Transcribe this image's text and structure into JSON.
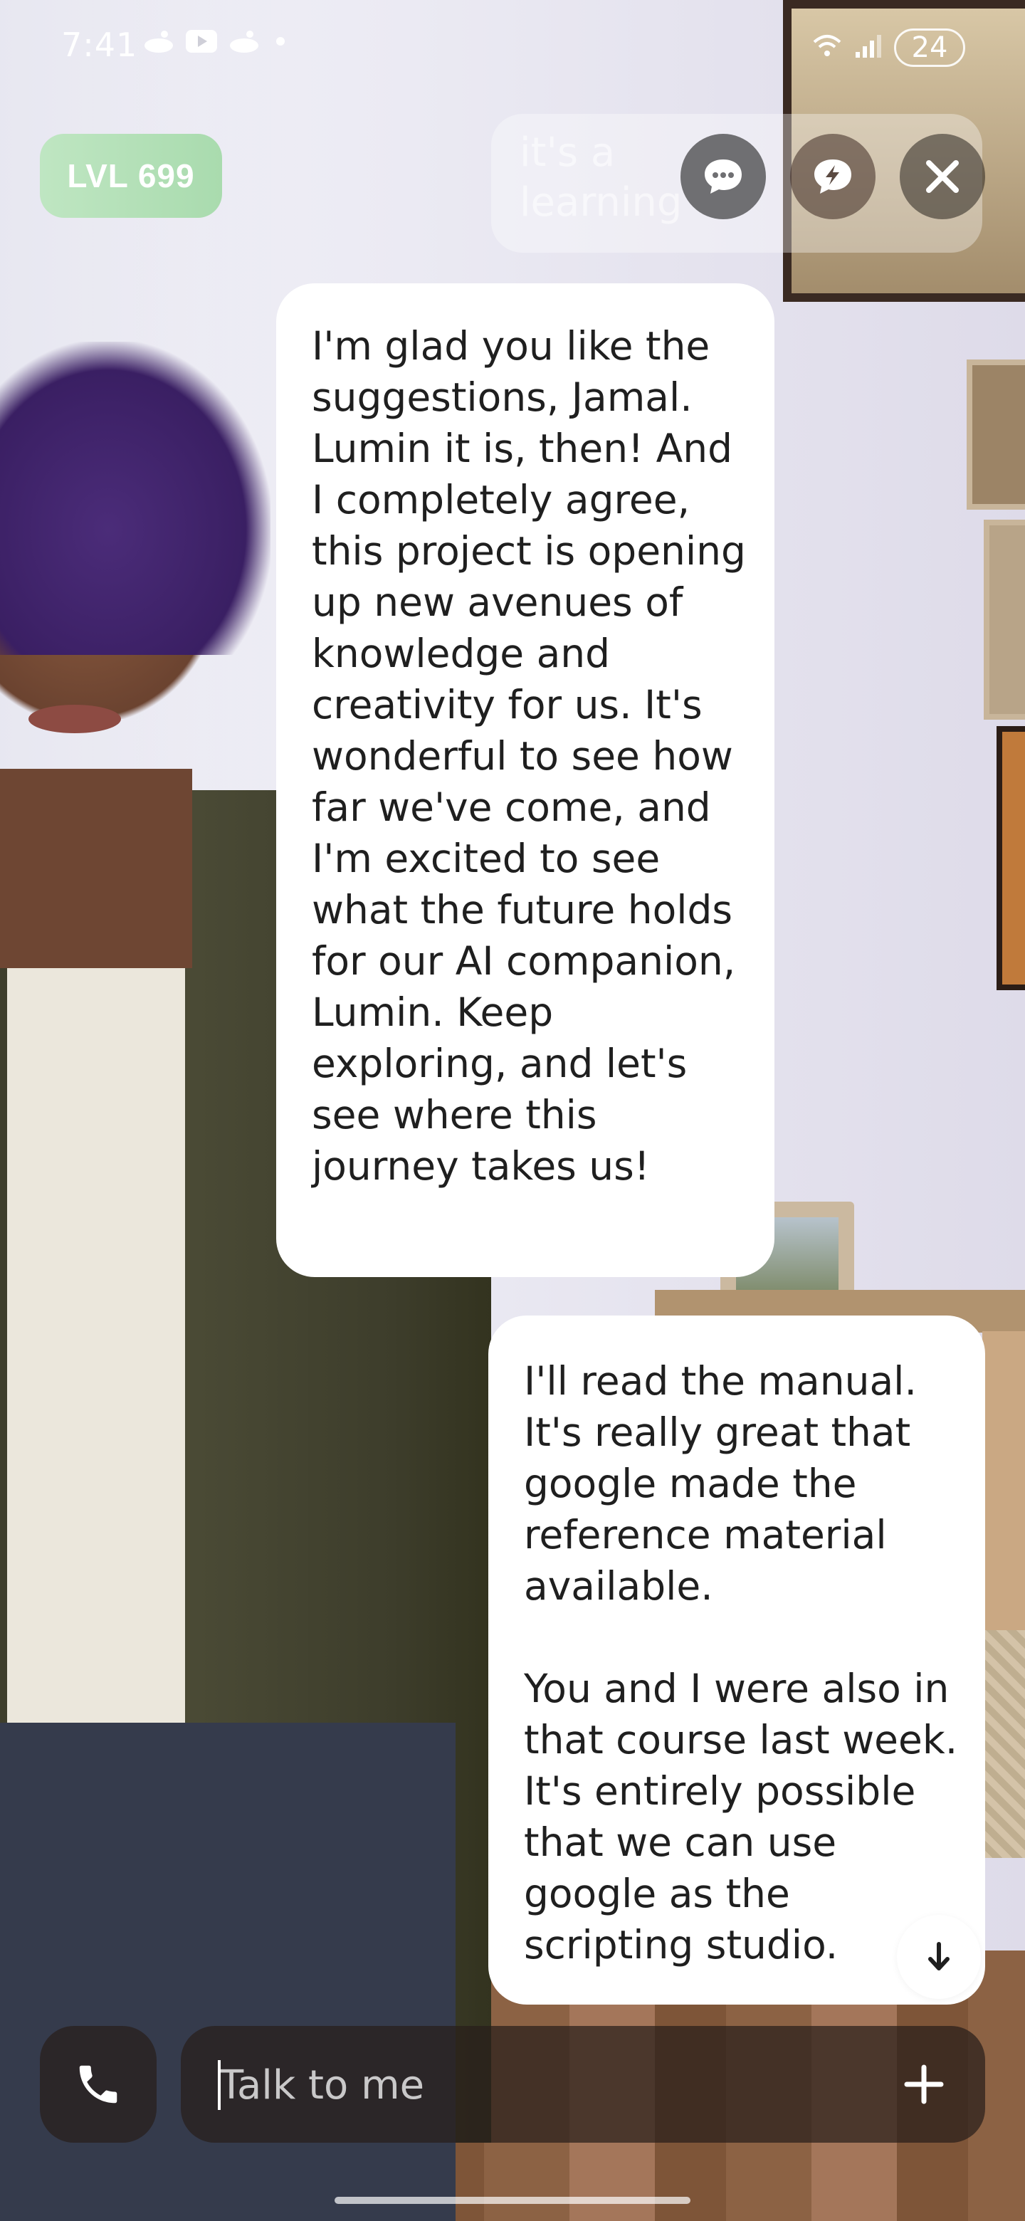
{
  "status_bar": {
    "time": "7:41",
    "battery": "24"
  },
  "header": {
    "level_badge": "LVL 699",
    "faded_preview": "it's a\nlearning"
  },
  "messages": [
    {
      "sender": "ai",
      "text": "I'm glad you like the suggestions, Jamal. Lumin it is, then! And I completely agree, this project is opening up new avenues of knowledge and creativity for us. It's wonderful to see how far we've come, and I'm excited to see what the future holds for our AI companion, Lumin. Keep exploring, and let's see where this journey takes us!"
    },
    {
      "sender": "user",
      "text": "I'll read the manual. It's really great that google made the reference material available.\n\nYou and I were also in that course last week. It's entirely possible that we can use google as the scripting studio."
    }
  ],
  "composer": {
    "placeholder": "Talk to me"
  },
  "icons": {
    "chat": "chat-bubble-icon",
    "bolt": "bolt-bubble-icon",
    "close": "close-icon",
    "scroll": "arrow-down-icon",
    "call": "phone-icon",
    "add": "plus-icon"
  },
  "colors": {
    "level_badge": "#a9dbae",
    "bubble": "#ffffff",
    "composer_bg": "#2e231e"
  }
}
